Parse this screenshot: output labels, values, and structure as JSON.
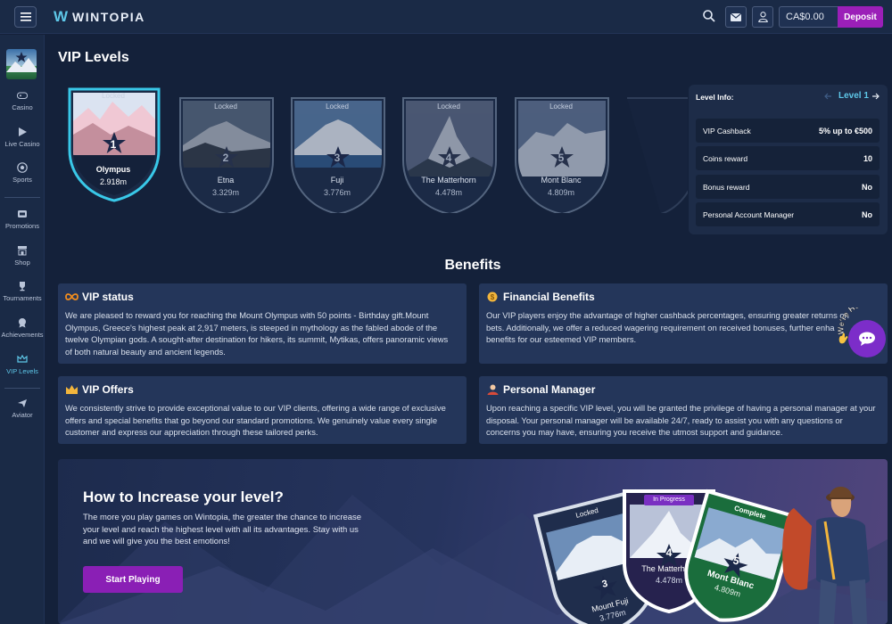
{
  "header": {
    "logo_mark": "W",
    "logo_text": "WINTOPIA",
    "balance": "CA$0.00",
    "deposit_label": "Deposit"
  },
  "sidebar": {
    "items": [
      {
        "label": "Casino",
        "icon": "gamepad-icon"
      },
      {
        "label": "Live Casino",
        "icon": "play-icon"
      },
      {
        "label": "Sports",
        "icon": "soccer-ball-icon"
      },
      {
        "label": "Promotions",
        "icon": "gift-icon"
      },
      {
        "label": "Shop",
        "icon": "shop-icon"
      },
      {
        "label": "Tournaments",
        "icon": "trophy-icon"
      },
      {
        "label": "Achievements",
        "icon": "medal-icon"
      },
      {
        "label": "VIP Levels",
        "icon": "crown-icon"
      },
      {
        "label": "Aviator",
        "icon": "plane-icon"
      }
    ]
  },
  "page_title": "VIP Levels",
  "levels": [
    {
      "status": "Locked",
      "num": "1",
      "name": "Olympus",
      "height": "2.918m",
      "active": true
    },
    {
      "status": "Locked",
      "num": "2",
      "name": "Etna",
      "height": "3.329m"
    },
    {
      "status": "Locked",
      "num": "3",
      "name": "Fuji",
      "height": "3.776m"
    },
    {
      "status": "Locked",
      "num": "4",
      "name": "The Matterhorn",
      "height": "4.478m"
    },
    {
      "status": "Locked",
      "num": "5",
      "name": "Mont Blanc",
      "height": "4.809m"
    }
  ],
  "level_info": {
    "title": "Level Info:",
    "level": "Level 1",
    "rows": [
      {
        "label": "VIP Cashback",
        "value": "5% up to €500"
      },
      {
        "label": "Coins reward",
        "value": "10"
      },
      {
        "label": "Bonus reward",
        "value": "No"
      },
      {
        "label": "Personal Account Manager",
        "value": "No"
      }
    ]
  },
  "benefits": {
    "title": "Benefits",
    "vip_status": {
      "title": "VIP status",
      "lines": [
        "We are pleased to reward you for reaching the Mount Olympus with 50 points - Birthday gift.Mount",
        "Olympus, Greece's highest peak at 2,917 meters, is steeped in mythology as the fabled abode of the",
        "twelve Olympian gods. A sought-after destination for hikers, its summit, Mytikas, offers panoramic views",
        "of both natural beauty and ancient legends."
      ]
    },
    "financial": {
      "title": "Financial Benefits",
      "lines": [
        "Our VIP players enjoy the advantage of higher cashback percentages, ensuring greater returns on",
        "bets. Additionally, we offer a reduced wagering requirement on received bonuses, further enha",
        "benefits for our esteemed VIP members."
      ]
    },
    "vip_offers": {
      "title": "VIP Offers",
      "lines": [
        "We consistently strive to provide exceptional value to our VIP clients, offering a wide range of exclusive",
        "offers and special benefits that go beyond our standard promotions. We genuinely value every single",
        "customer and express our appreciation through these tailored perks."
      ]
    },
    "personal_manager": {
      "title": "Personal Manager",
      "lines": [
        "Upon reaching a specific VIP level, you will be granted the privilege of having a personal manager at your",
        "disposal. Your personal manager will be available 24/7, ready to assist you with any questions or",
        "concerns you may have, ensuring you receive the utmost support and guidance."
      ]
    }
  },
  "increase": {
    "title": "How to Increase your level?",
    "lines": [
      "The more you play games on Wintopia, the greater the chance to increase",
      "your level and reach the highest level with all its advantages. Stay with us",
      "and we will give you the best emotions!"
    ],
    "button": "Start Playing",
    "cards": [
      {
        "status": "Locked",
        "num": "3",
        "name": "Mount Fuji",
        "height": "3.776m"
      },
      {
        "status": "In Progress",
        "num": "4",
        "name": "The Matterhorn",
        "height": "4.478m"
      },
      {
        "status": "Complete",
        "num": "5",
        "name": "Mont Blanc",
        "height": "4.809m"
      }
    ]
  },
  "chat": {
    "label": "We're Here!"
  },
  "colors": {
    "accent": "#5ec7e8",
    "purple": "#9b1fb8",
    "bg": "#14213a"
  }
}
